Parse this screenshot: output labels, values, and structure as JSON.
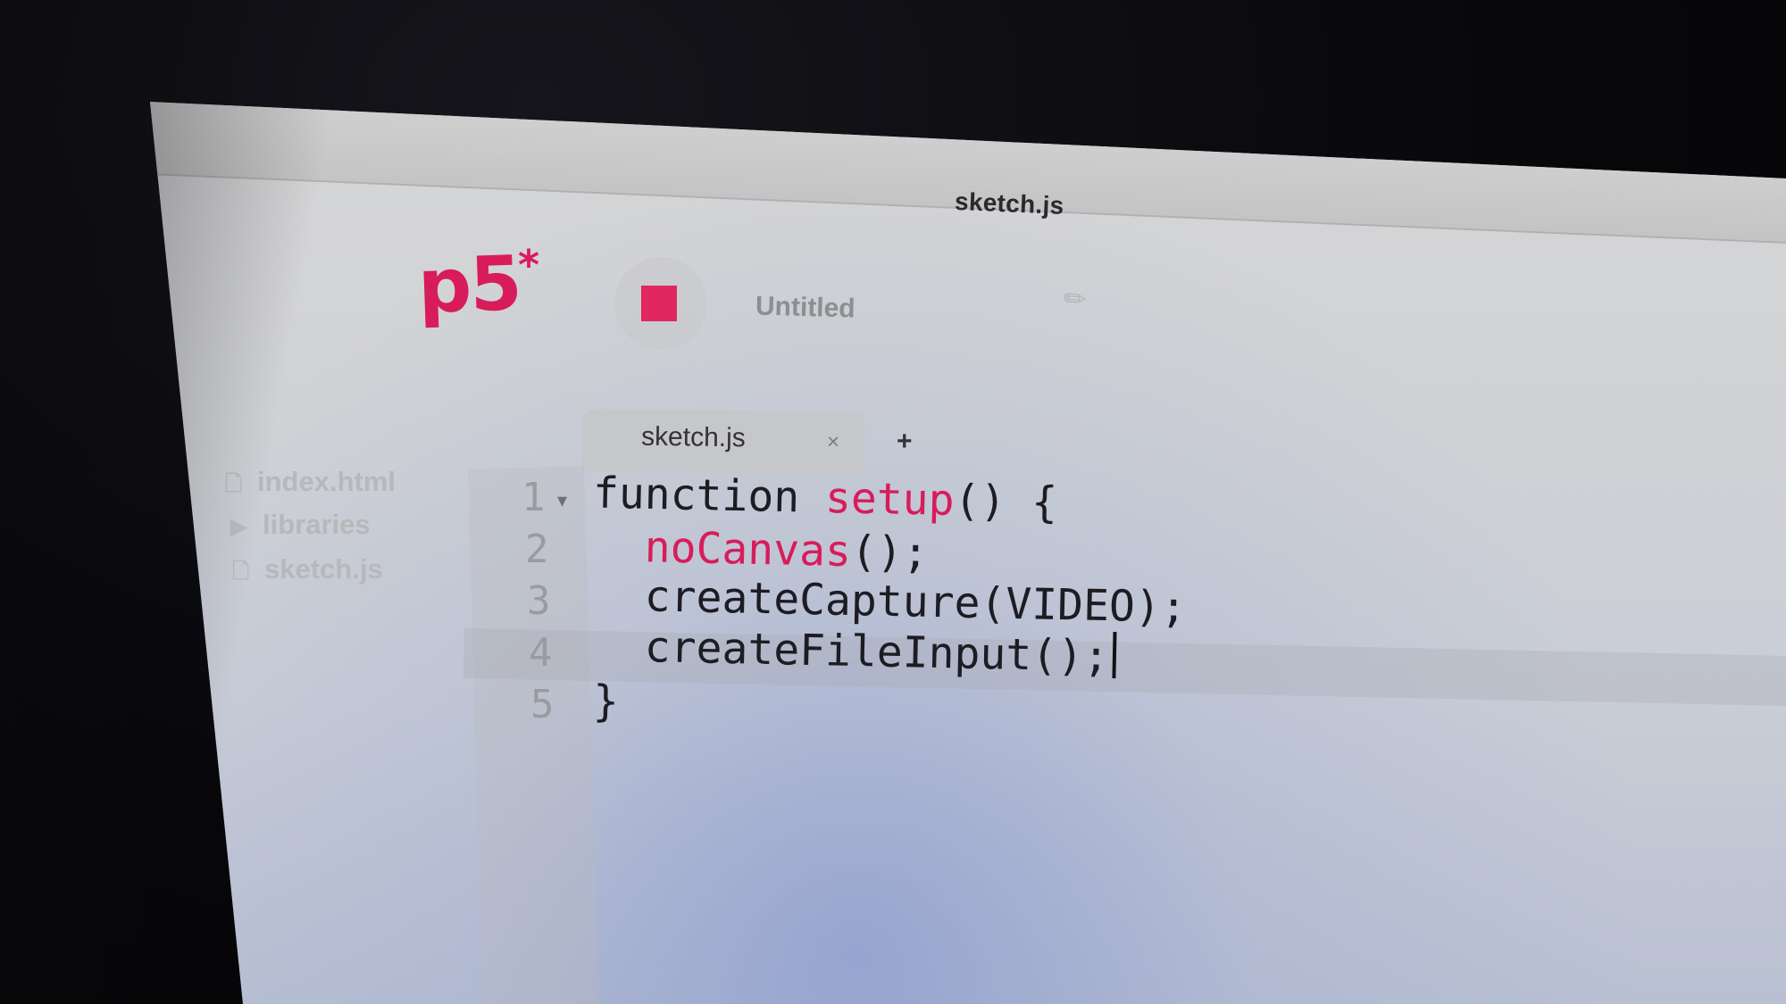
{
  "window": {
    "title": "sketch.js"
  },
  "header": {
    "logo_text": "p5",
    "logo_star": "*",
    "project_name": "Untitled"
  },
  "sidebar": {
    "items": [
      {
        "label": "index.html",
        "icon": "file-icon"
      },
      {
        "label": "libraries",
        "icon": "caret-right-icon"
      },
      {
        "label": "sketch.js",
        "icon": "file-icon"
      }
    ]
  },
  "tabs": [
    {
      "label": "sketch.js",
      "close": "×"
    }
  ],
  "add_tab_label": "+",
  "editor": {
    "line_numbers": [
      "1",
      "2",
      "3",
      "4",
      "5"
    ],
    "lines": [
      {
        "parts": [
          "function ",
          "setup",
          "() {"
        ]
      },
      {
        "parts": [
          "  ",
          "noCanvas",
          "();"
        ]
      },
      {
        "text": "  createCapture(VIDEO);"
      },
      {
        "text": "  createFileInput();"
      },
      {
        "text": "}"
      }
    ]
  },
  "colors": {
    "accent": "#d81c5a",
    "stop_button": "#e0285f"
  }
}
